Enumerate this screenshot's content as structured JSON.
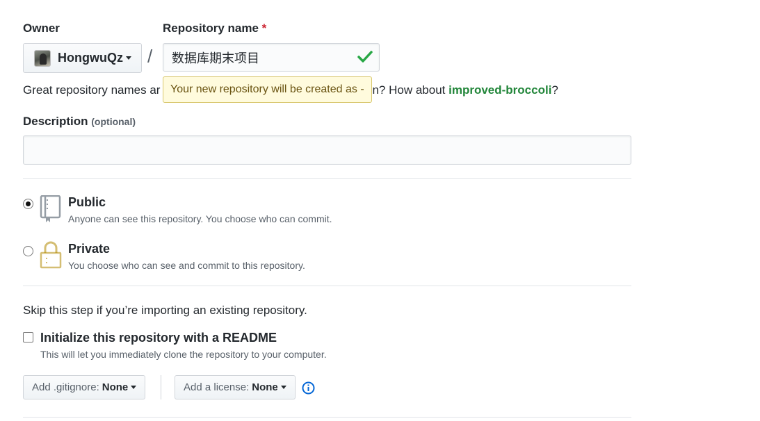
{
  "owner": {
    "label": "Owner",
    "name": "HongwuQz"
  },
  "repo": {
    "label": "Repository name",
    "required_mark": "*",
    "value": "数据库期末项目",
    "separator": "/"
  },
  "hint": {
    "prefix": "Great repository names ar",
    "suffix": "n? How about ",
    "suggestion": "improved-broccoli",
    "end": "?"
  },
  "tooltip": {
    "text": "Your new repository will be created as -"
  },
  "description": {
    "label": "Description",
    "optional": "(optional)",
    "value": ""
  },
  "visibility": {
    "public": {
      "title": "Public",
      "desc": "Anyone can see this repository. You choose who can commit.",
      "checked": true
    },
    "private": {
      "title": "Private",
      "desc": "You choose who can see and commit to this repository.",
      "checked": false
    }
  },
  "init": {
    "skip_text": "Skip this step if you’re importing an existing repository.",
    "readme_label": "Initialize this repository with a README",
    "readme_desc": "This will let you immediately clone the repository to your computer."
  },
  "gitignore": {
    "label": "Add .gitignore:",
    "value": "None"
  },
  "license": {
    "label": "Add a license:",
    "value": "None"
  },
  "colors": {
    "check": "#28a745",
    "suggestion": "#22863a",
    "tooltip_bg": "#fffbdd",
    "info": "#0366d6",
    "required": "#cb2431"
  }
}
